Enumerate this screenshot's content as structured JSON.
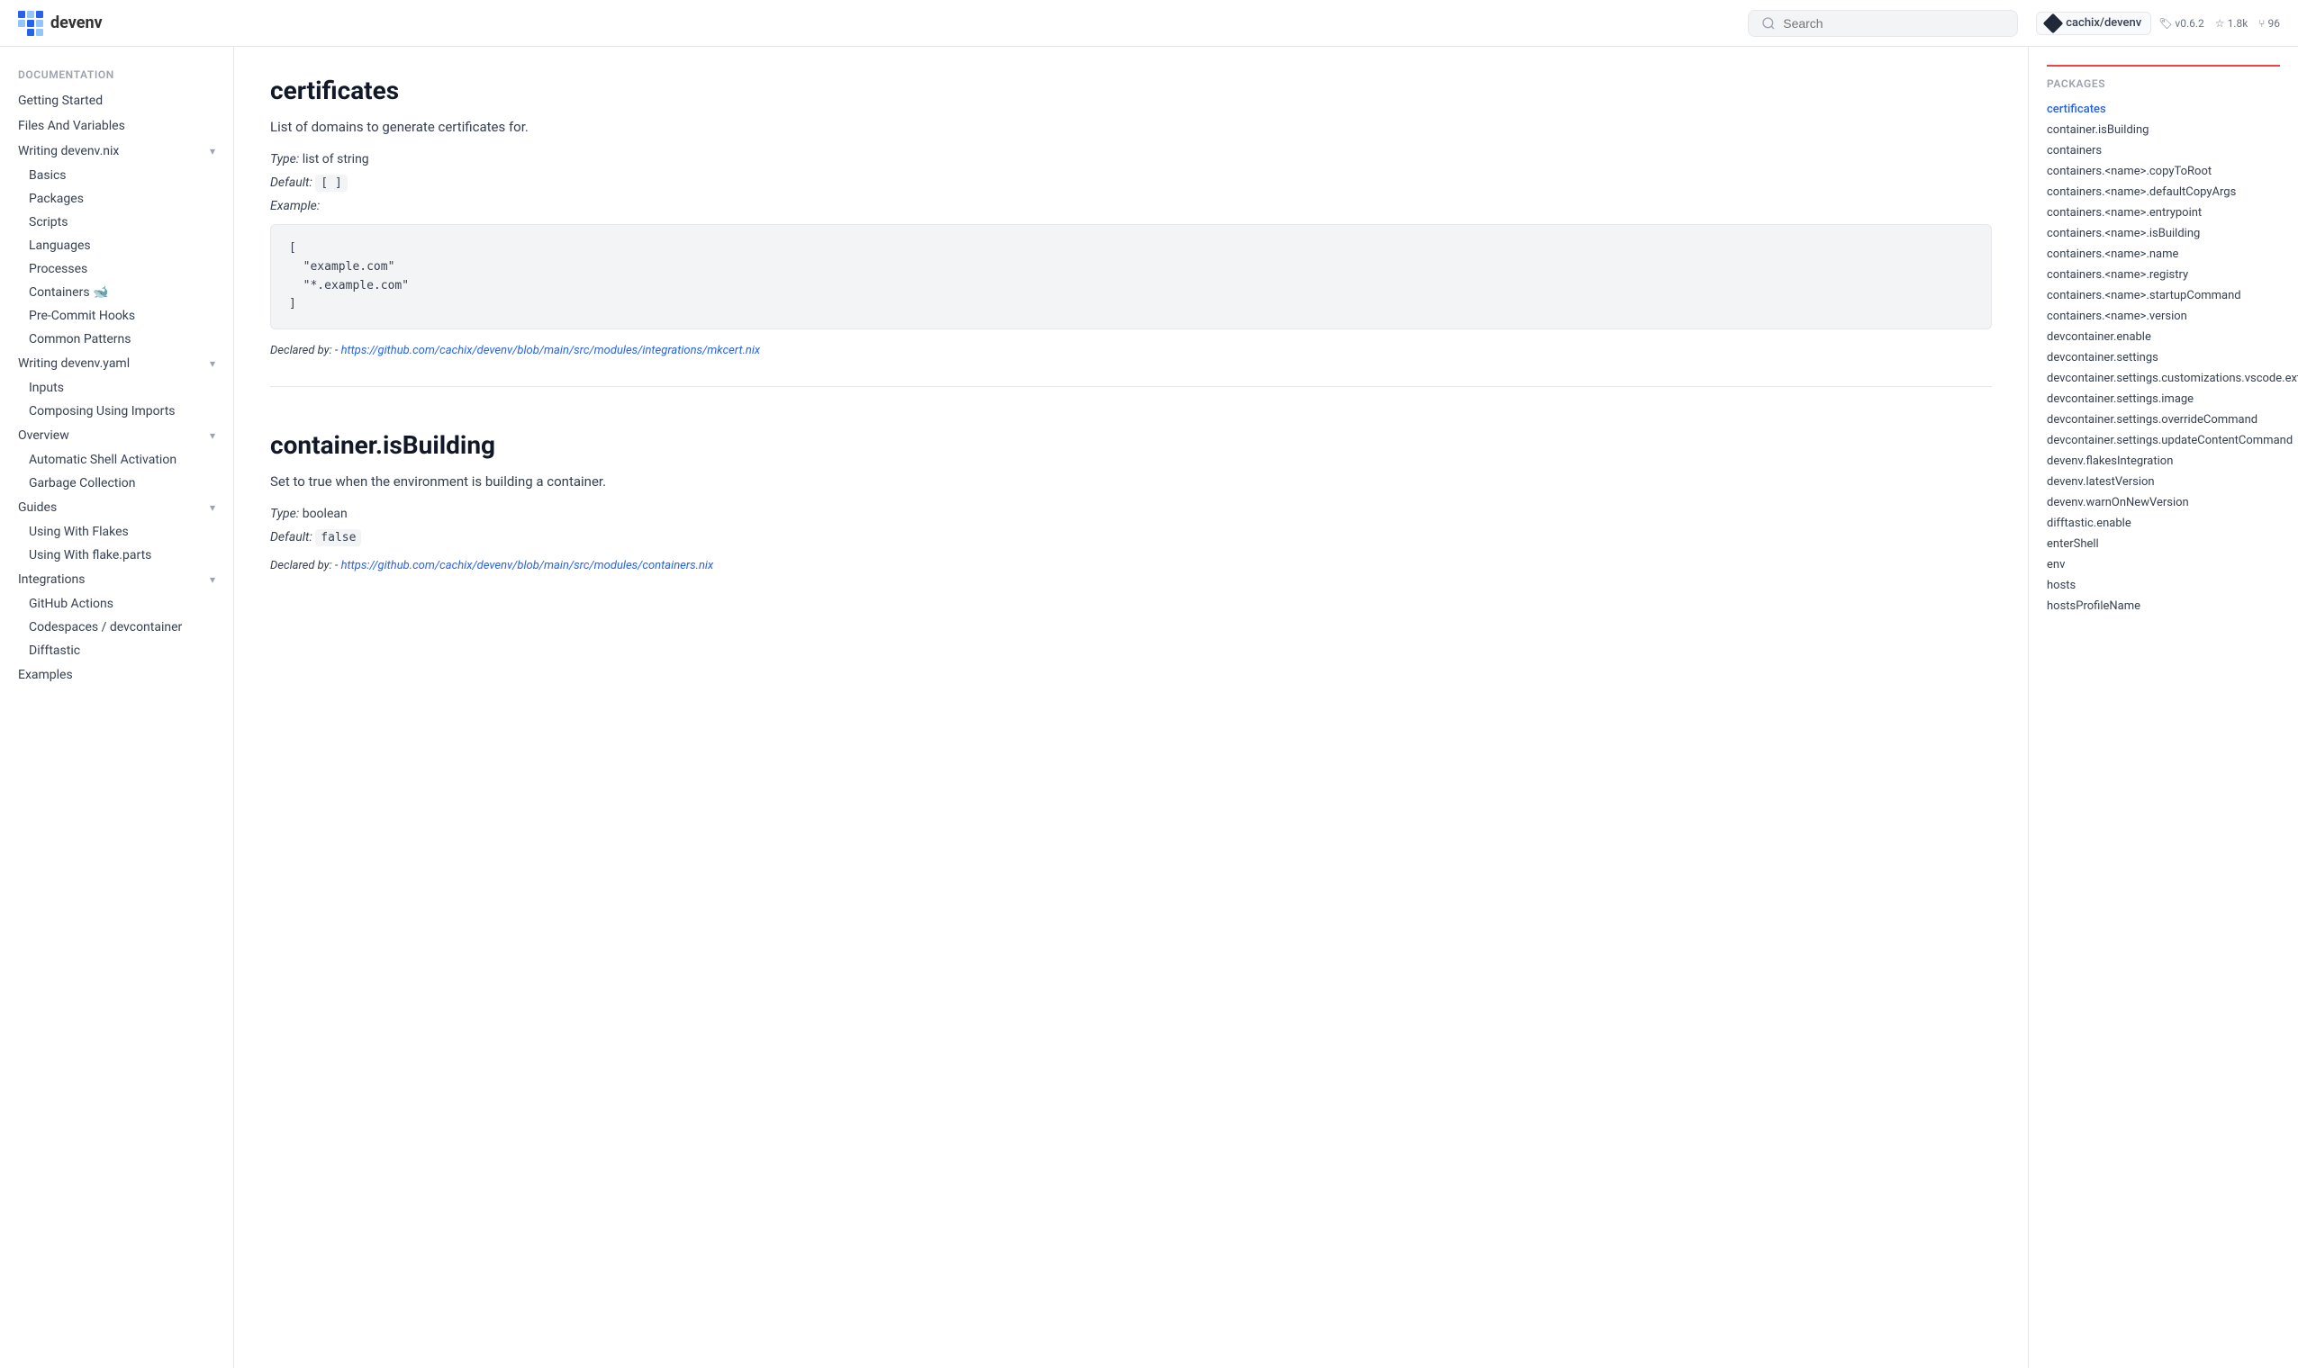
{
  "header": {
    "logo_text": "devenv",
    "search_placeholder": "Search",
    "repo_name": "cachix/devenv",
    "repo_version": "v0.6.2",
    "repo_stars": "1.8k",
    "repo_forks": "96"
  },
  "sidebar": {
    "section_documentation": "Documentation",
    "items": [
      {
        "label": "Getting Started",
        "id": "getting-started",
        "level": 1
      },
      {
        "label": "Files And Variables",
        "id": "files-and-variables",
        "level": 1
      },
      {
        "label": "Writing devenv.nix",
        "id": "writing-devenv-nix",
        "level": 1,
        "expandable": true,
        "expanded": true
      },
      {
        "label": "Basics",
        "id": "basics",
        "level": 2
      },
      {
        "label": "Packages",
        "id": "packages",
        "level": 2
      },
      {
        "label": "Scripts",
        "id": "scripts",
        "level": 2
      },
      {
        "label": "Languages",
        "id": "languages",
        "level": 2
      },
      {
        "label": "Processes",
        "id": "processes",
        "level": 2
      },
      {
        "label": "Containers 🐋",
        "id": "containers",
        "level": 2
      },
      {
        "label": "Pre-Commit Hooks",
        "id": "pre-commit-hooks",
        "level": 2
      },
      {
        "label": "Common Patterns",
        "id": "common-patterns",
        "level": 2
      },
      {
        "label": "Writing devenv.yaml",
        "id": "writing-devenv-yaml",
        "level": 1,
        "expandable": true,
        "expanded": true
      },
      {
        "label": "Inputs",
        "id": "inputs",
        "level": 2
      },
      {
        "label": "Composing Using Imports",
        "id": "composing-using-imports",
        "level": 2
      },
      {
        "label": "Overview",
        "id": "overview",
        "level": 1,
        "expandable": true,
        "expanded": true
      },
      {
        "label": "Automatic Shell Activation",
        "id": "automatic-shell-activation",
        "level": 2
      },
      {
        "label": "Garbage Collection",
        "id": "garbage-collection",
        "level": 2
      },
      {
        "label": "Guides",
        "id": "guides",
        "level": 1,
        "expandable": true,
        "expanded": true
      },
      {
        "label": "Using With Flakes",
        "id": "using-with-flakes",
        "level": 2
      },
      {
        "label": "Using With flake.parts",
        "id": "using-with-flake-parts",
        "level": 2
      },
      {
        "label": "Integrations",
        "id": "integrations",
        "level": 1,
        "expandable": true,
        "expanded": true
      },
      {
        "label": "GitHub Actions",
        "id": "github-actions",
        "level": 2
      },
      {
        "label": "Codespaces / devcontainer",
        "id": "codespaces-devcontainer",
        "level": 2
      },
      {
        "label": "Difftastic",
        "id": "difftastic",
        "level": 2
      },
      {
        "label": "Examples",
        "id": "examples",
        "level": 1
      }
    ]
  },
  "main": {
    "sections": [
      {
        "id": "certificates",
        "title": "certificates",
        "description": "List of domains to generate certificates for.",
        "type_label": "Type:",
        "type_value": "list of string",
        "default_label": "Default:",
        "default_value": "[ ]",
        "example_label": "Example:",
        "code": "[\n  \"example.com\"\n  \"*.example.com\"\n]",
        "declared_by_text": "Declared by:",
        "declared_by_link_text": "https://github.com/cachix/devenv/blob/main/src/modules/integrations/mkcert.nix",
        "declared_by_link_href": "https://github.com/cachix/devenv/blob/main/src/modules/integrations/mkcert.nix"
      },
      {
        "id": "container-is-building",
        "title": "container.isBuilding",
        "description": "Set to true when the environment is building a container.",
        "type_label": "Type:",
        "type_value": "boolean",
        "default_label": "Default:",
        "default_value": "false",
        "declared_by_text": "Declared by:",
        "declared_by_link_text": "https://github.com/cachix/devenv/blob/main/src/modules/containers.nix",
        "declared_by_link_href": "https://github.com/cachix/devenv/blob/main/src/modules/containers.nix"
      }
    ]
  },
  "toc": {
    "section_label": "packages",
    "items": [
      {
        "label": "certificates",
        "id": "certificates",
        "active": true
      },
      {
        "label": "container.isBuilding",
        "id": "container-is-building"
      },
      {
        "label": "containers",
        "id": "containers"
      },
      {
        "label": "containers.<name>.copyToRoot",
        "id": "containers-name-copytoroot"
      },
      {
        "label": "containers.<name>.defaultCopyArgs",
        "id": "containers-name-defaultcopyargs"
      },
      {
        "label": "containers.<name>.entrypoint",
        "id": "containers-name-entrypoint"
      },
      {
        "label": "containers.<name>.isBuilding",
        "id": "containers-name-isbuilding"
      },
      {
        "label": "containers.<name>.name",
        "id": "containers-name-name"
      },
      {
        "label": "containers.<name>.registry",
        "id": "containers-name-registry"
      },
      {
        "label": "containers.<name>.startupCommand",
        "id": "containers-name-startupcommand"
      },
      {
        "label": "containers.<name>.version",
        "id": "containers-name-version"
      },
      {
        "label": "devcontainer.enable",
        "id": "devcontainer-enable"
      },
      {
        "label": "devcontainer.settings",
        "id": "devcontainer-settings"
      },
      {
        "label": "devcontainer.settings.customizations.vscode.extensions",
        "id": "devcontainer-settings-customizations-vscode-extensions"
      },
      {
        "label": "devcontainer.settings.image",
        "id": "devcontainer-settings-image"
      },
      {
        "label": "devcontainer.settings.overrideCommand",
        "id": "devcontainer-settings-overridecommand"
      },
      {
        "label": "devcontainer.settings.updateContentCommand",
        "id": "devcontainer-settings-updatecontentcommand"
      },
      {
        "label": "devenv.flakesIntegration",
        "id": "devenv-flakesintegration"
      },
      {
        "label": "devenv.latestVersion",
        "id": "devenv-latestversion"
      },
      {
        "label": "devenv.warnOnNewVersion",
        "id": "devenv-warnonnewversion"
      },
      {
        "label": "difftastic.enable",
        "id": "difftastic-enable"
      },
      {
        "label": "enterShell",
        "id": "entershell"
      },
      {
        "label": "env",
        "id": "env"
      },
      {
        "label": "hosts",
        "id": "hosts"
      },
      {
        "label": "hostsProfileName",
        "id": "hostsprofilename"
      }
    ]
  }
}
